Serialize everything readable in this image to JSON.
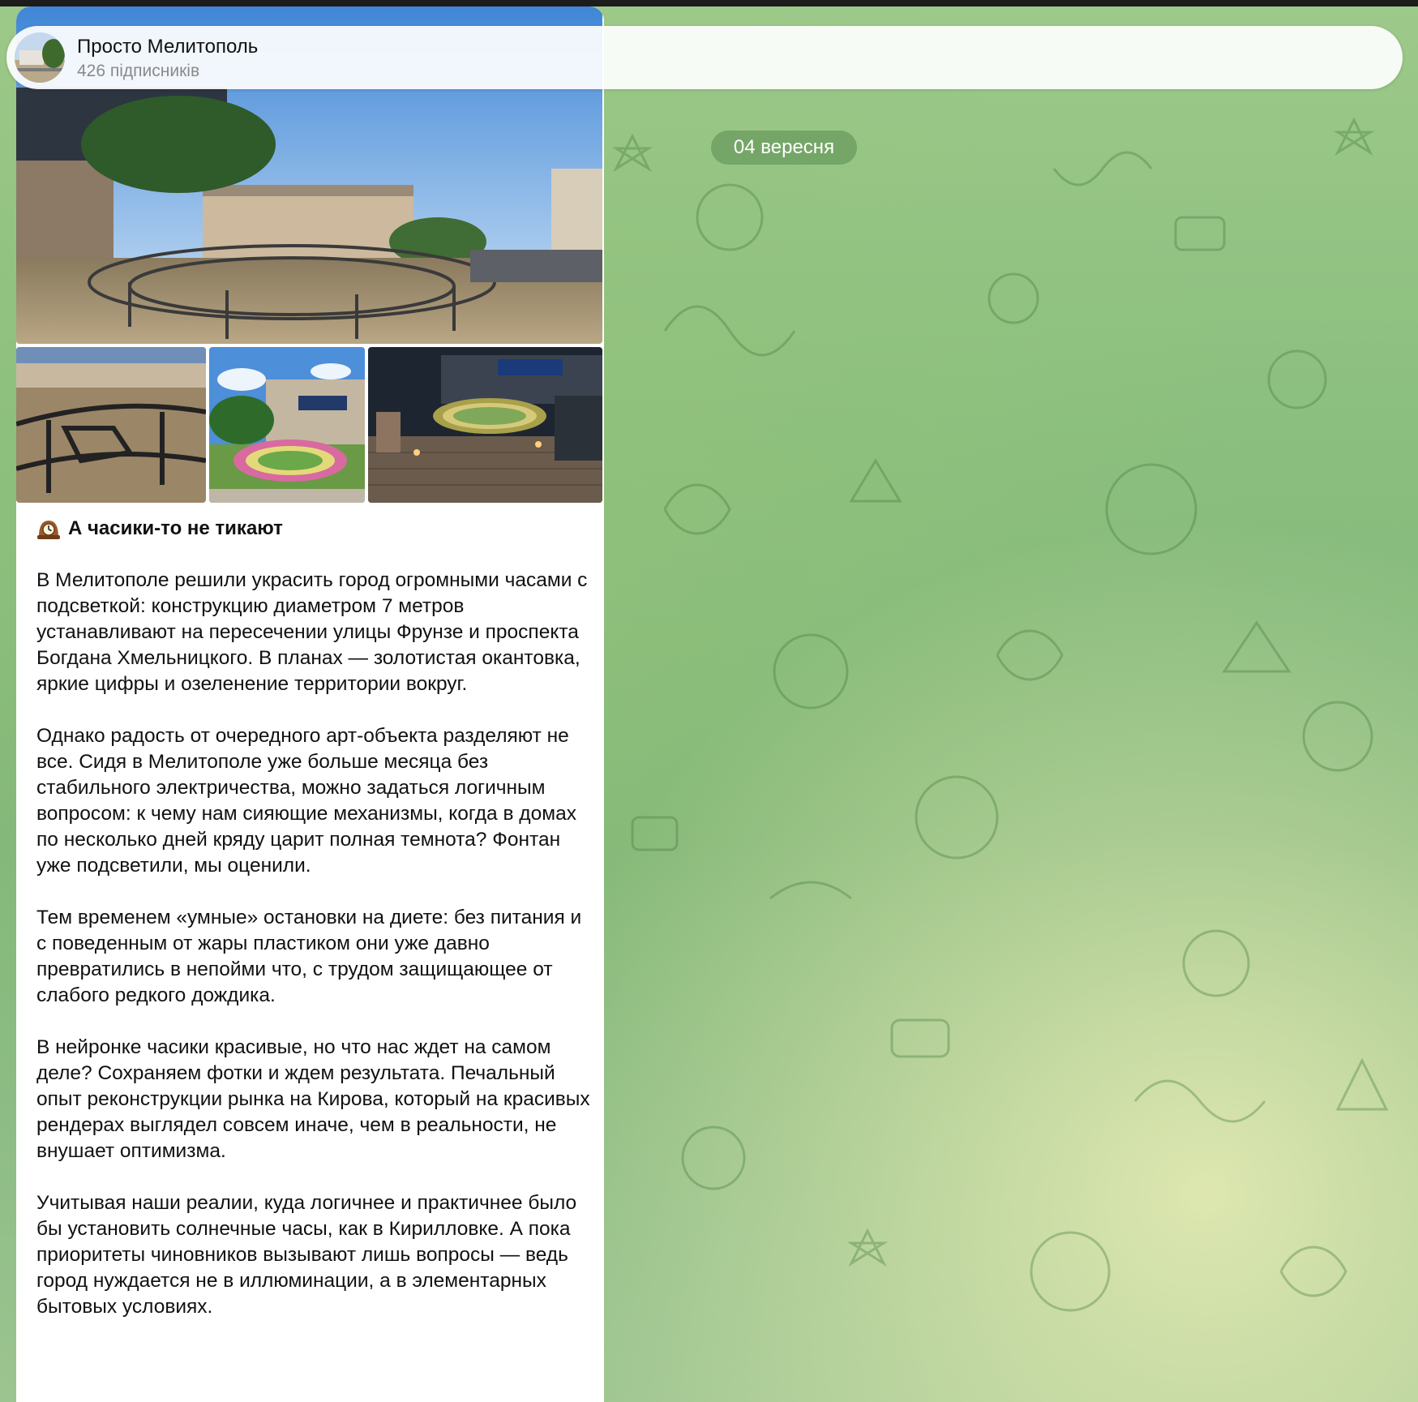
{
  "header": {
    "title": "Просто Мелитополь",
    "subtitle": "426 підписників"
  },
  "date_separator": "04 вересня",
  "post": {
    "title": "А часики-то не тикают",
    "title_icon": "mantelpiece-clock-icon",
    "paragraphs": [
      "В Мелитополе решили украсить город огромными часами с подсветкой: конструкцию диаметром 7 метров устанавливают на пересечении улицы Фрунзе и проспекта Богдана Хмельницкого. В планах — золотистая окантовка, яркие цифры и озеленение территории вокруг.",
      "Однако радость от очередного арт-объекта разделяют не все. Сидя в Мелитополе уже больше месяца без стабильного электричества, можно задаться логичным вопросом: к чему нам сияющие механизмы, когда в домах по несколько дней кряду царит полная темнота?  Фонтан уже подсветили, мы оценили.",
      "Тем временем «умные» остановки на диете: без питания и с поведенным от жары пластиком они уже давно превратились в непойми что, с трудом защищающее от слабого редкого дождика.",
      "В нейронке часики красивые, но что нас ждет на самом деле? Сохраняем фотки и ждем результата. Печальный опыт реконструкции рынка на Кирова, который на красивых рендерах выглядел совсем иначе, чем в реальности, не внушает оптимизма.",
      "Учитывая наши реалии, куда логичнее и практичнее было бы установить солнечные часы, как в Кирилловке. А пока приоритеты чиновников вызывают лишь вопросы — ведь город нуждается не в иллюминации, а в элементарных бытовых условиях."
    ]
  },
  "colors": {
    "chat_background": "#8bbf7f",
    "bubble": "#ffffff",
    "date_pill": "#5a8c50"
  }
}
